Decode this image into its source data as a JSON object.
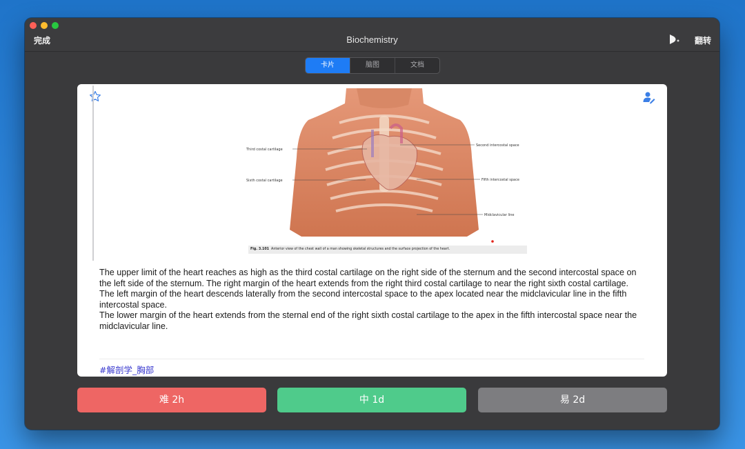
{
  "window": {
    "title": "Biochemistry"
  },
  "toolbar": {
    "done_label": "完成",
    "flip_label": "翻转",
    "tts_icon": "speaker-icon"
  },
  "tabs": [
    {
      "label": "卡片",
      "active": true
    },
    {
      "label": "脑图",
      "active": false
    },
    {
      "label": "文档",
      "active": false
    }
  ],
  "card": {
    "star_icon": "star-outline-icon",
    "person_icon": "person-edit-icon",
    "figure": {
      "labels": {
        "third_costal": "Third costal cartilage",
        "sixth_costal": "Sixth costal cartilage",
        "second_intercostal": "Second intercostal space",
        "fifth_intercostal": "Fifth intercostal space",
        "midclavicular": "Midclavicular line"
      },
      "caption_number": "Fig. 3.101",
      "caption_text": "Anterior view of the chest wall of a man showing skeletal structures and the surface projection of the heart."
    },
    "paragraphs": [
      "The upper limit of the heart reaches as high as the third costal cartilage on the right side of the sternum and the second intercostal space on the left side of the sternum. The right margin of the heart extends from the right third costal cartilage to near the right sixth costal cartilage.",
      " The left margin of the heart descends laterally from the second intercostal space to the apex located near the midclavicular line in the fifth intercostal space.",
      " The lower margin of the heart extends from the sternal end of the right sixth costal cartilage to the apex in the fifth intercostal space near the midclavicular line."
    ],
    "tag": "#解剖学_胸部"
  },
  "ratings": {
    "hard": {
      "label": "难 2h",
      "color": "#ee6664"
    },
    "medium": {
      "label": "中 1d",
      "color": "#4fcb8b"
    },
    "easy": {
      "label": "易 2d",
      "color": "#7d7d80"
    }
  }
}
